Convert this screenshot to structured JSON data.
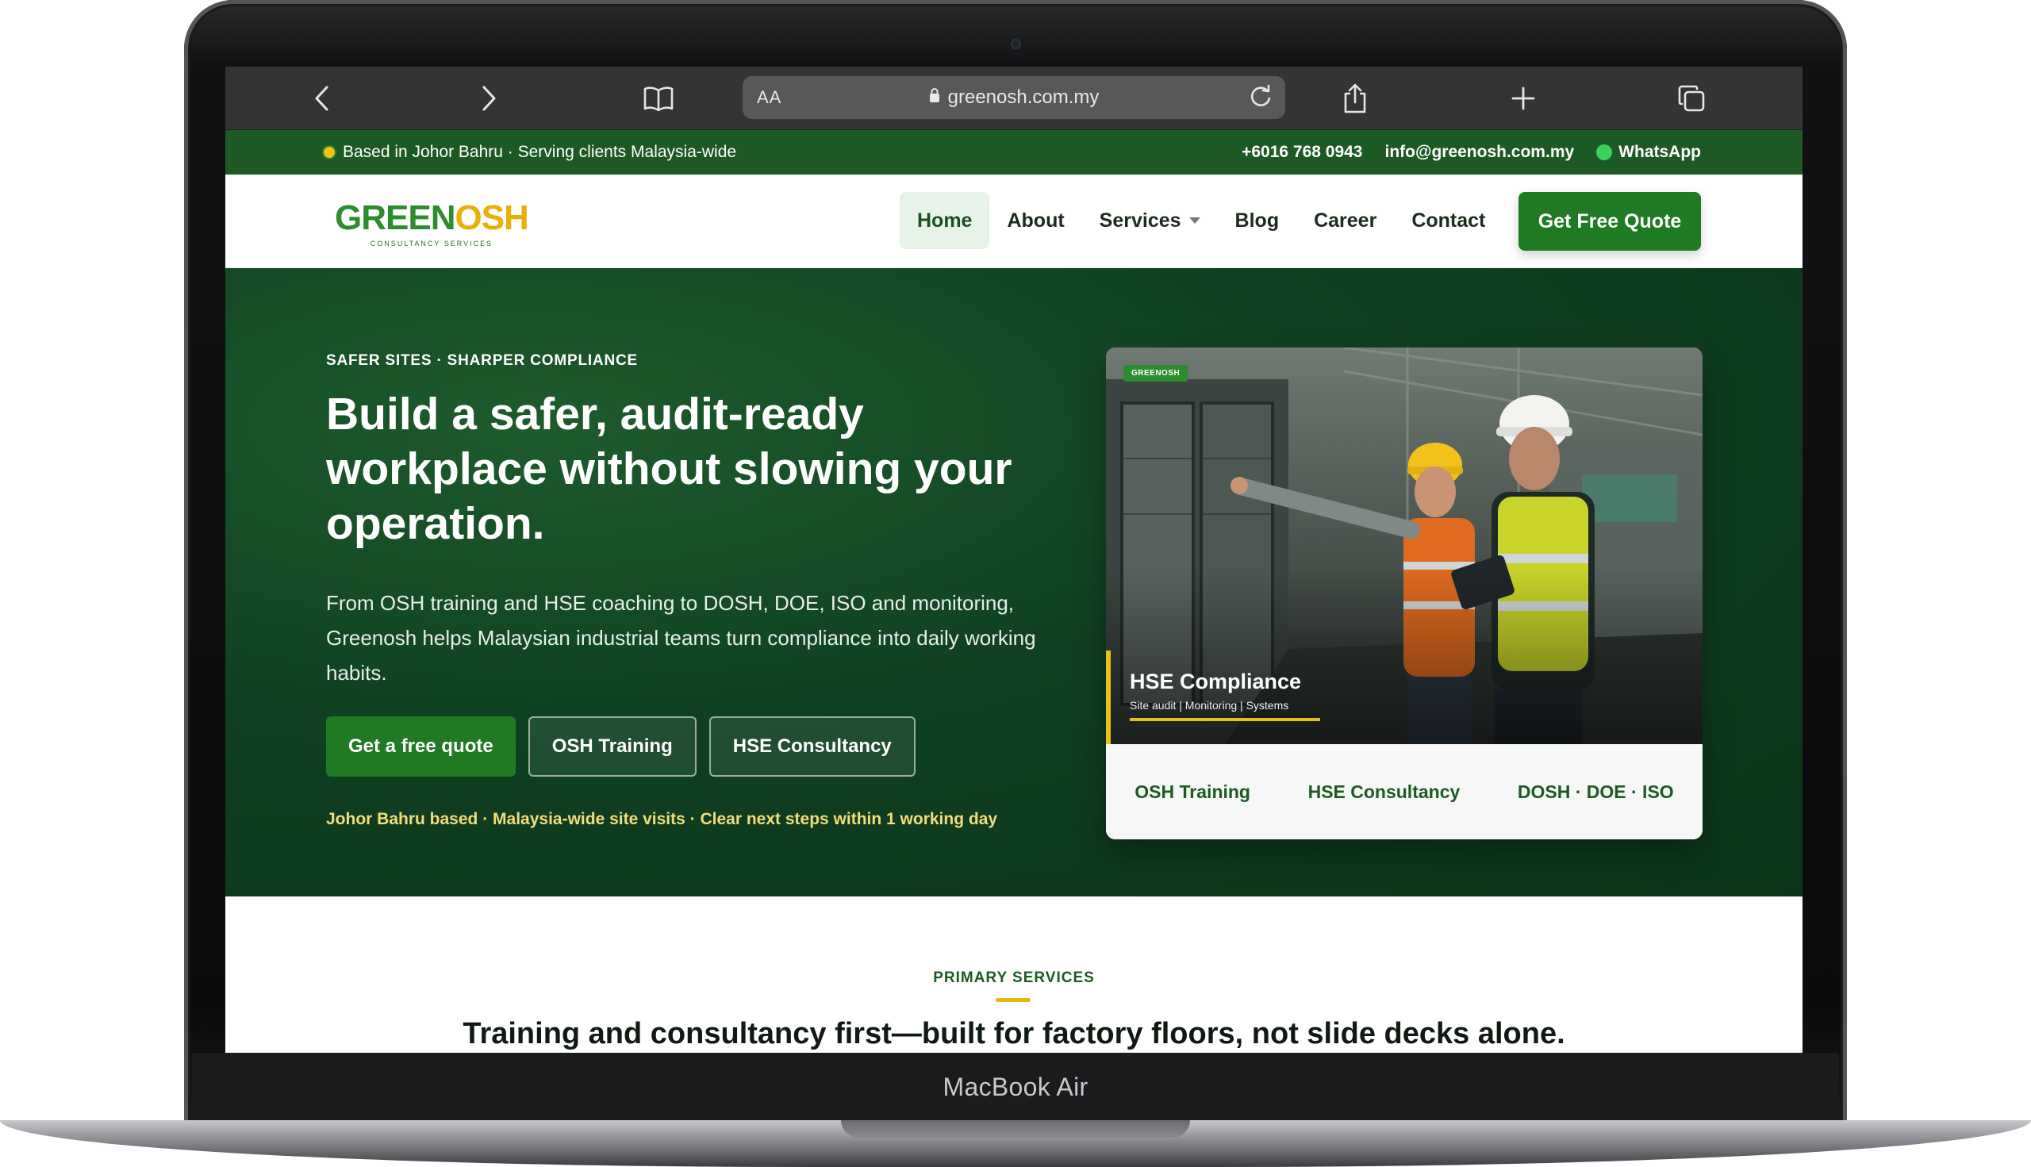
{
  "device": {
    "brand_label": "MacBook Air"
  },
  "browser": {
    "text_size_label": "AA",
    "url": "greenosh.com.my",
    "icons": [
      "back-icon",
      "forward-icon",
      "bookmarks-icon",
      "lock-icon",
      "reload-icon",
      "share-icon",
      "new-tab-icon",
      "tabs-icon"
    ]
  },
  "infobar": {
    "location": "Based in Johor Bahru · Serving clients Malaysia-wide",
    "phone": "+6016 768 0943",
    "email": "info@greenosh.com.my",
    "whatsapp": "WhatsApp"
  },
  "logo": {
    "word_part1": "GREEN",
    "word_part2": "OSH",
    "tagline": "CONSULTANCY SERVICES"
  },
  "nav": {
    "items": [
      {
        "label": "Home",
        "active": true
      },
      {
        "label": "About"
      },
      {
        "label": "Services",
        "dropdown": true
      },
      {
        "label": "Blog"
      },
      {
        "label": "Career"
      },
      {
        "label": "Contact"
      }
    ],
    "cta": "Get Free Quote"
  },
  "hero": {
    "eyebrow": "SAFER SITES · SHARPER COMPLIANCE",
    "title": "Build a safer, audit-ready workplace without slowing your operation.",
    "lead": "From OSH training and HSE coaching to DOSH, DOE, ISO and monitoring, Greenosh helps Malaysian industrial teams turn compliance into daily working habits.",
    "buttons": [
      "Get a free quote",
      "OSH Training",
      "HSE Consultancy"
    ],
    "note": "Johor Bahru based · Malaysia-wide site visits · Clear next steps within 1 working day"
  },
  "card": {
    "badge": "GREENOSH",
    "caption_title": "HSE Compliance",
    "caption_sub": "Site audit | Monitoring | Systems",
    "tabs": [
      "OSH Training",
      "HSE Consultancy",
      "DOSH · DOE · ISO"
    ]
  },
  "services": {
    "eyebrow": "PRIMARY SERVICES",
    "title": "Training and consultancy first—built for factory floors, not slide decks alone."
  },
  "colors": {
    "brand_green": "#1f7a23",
    "infobar_green": "#1d5a23",
    "accent_yellow": "#e6c11a",
    "hero_dark": "#0f4021"
  }
}
